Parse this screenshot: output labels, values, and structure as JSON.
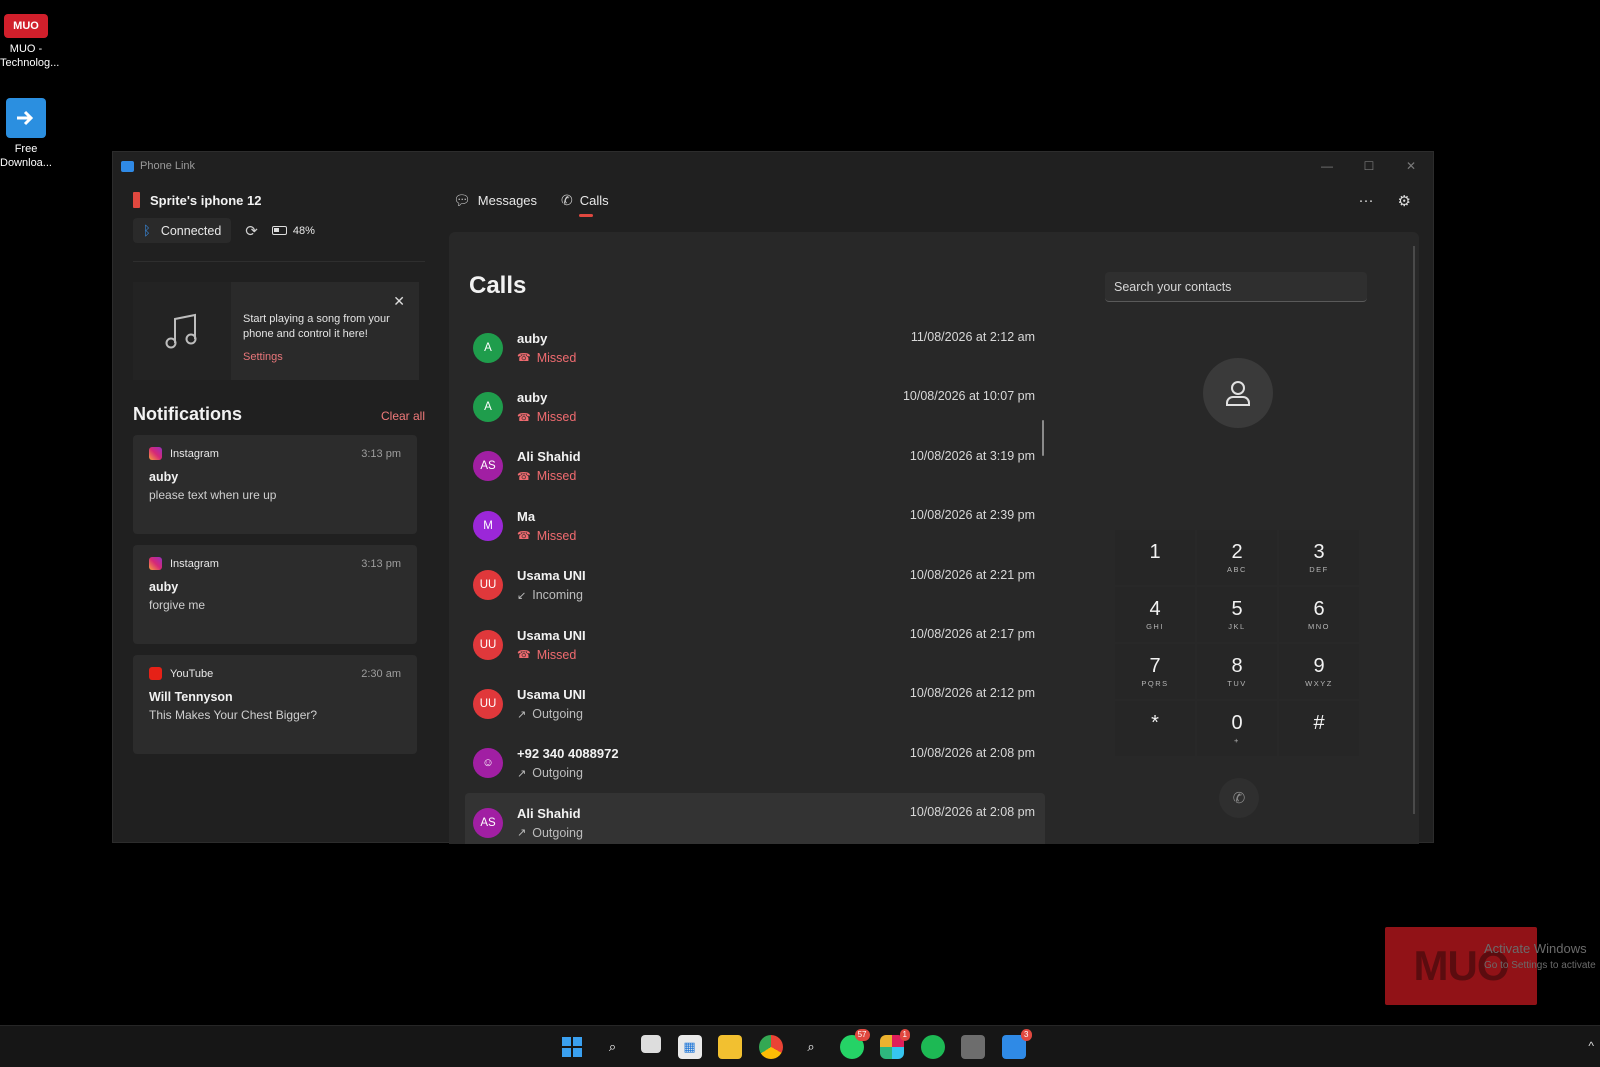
{
  "desktop": {
    "icons": [
      {
        "glyph": "MUO",
        "label": "MUO - Technolog..."
      },
      {
        "glyph": "download-arrow-icon",
        "label": "Free Downloa..."
      }
    ]
  },
  "window": {
    "title": "Phone Link",
    "controls": {
      "minimize": "—",
      "maximize": "☐",
      "close": "✕"
    }
  },
  "device": {
    "name": "Sprite's iphone 12",
    "status": "Connected",
    "battery": "48%"
  },
  "music": {
    "text": "Start playing a song from your phone and control it here!",
    "link": "Settings"
  },
  "notifications": {
    "title": "Notifications",
    "clear_label": "Clear all",
    "items": [
      {
        "app": "Instagram",
        "time": "3:13 pm",
        "who": "auby",
        "body": "please text when ure up"
      },
      {
        "app": "Instagram",
        "time": "3:13 pm",
        "who": "auby",
        "body": "forgive me"
      },
      {
        "app": "YouTube",
        "time": "2:30 am",
        "who": "Will Tennyson",
        "body": "This Makes Your Chest Bigger?"
      }
    ]
  },
  "tabs": {
    "messages": "Messages",
    "calls": "Calls",
    "more": "···"
  },
  "calls": {
    "title": "Calls",
    "items": [
      {
        "initials": "A",
        "name": "auby",
        "status": "Missed",
        "time": "11/08/2026 at 2:12 am"
      },
      {
        "initials": "A",
        "name": "auby",
        "status": "Missed",
        "time": "10/08/2026 at 10:07 pm"
      },
      {
        "initials": "AS",
        "name": "Ali Shahid",
        "status": "Missed",
        "time": "10/08/2026 at 3:19 pm"
      },
      {
        "initials": "M",
        "name": "Ma",
        "status": "Missed",
        "time": "10/08/2026 at 2:39 pm"
      },
      {
        "initials": "UU",
        "name": "Usama UNI",
        "status": "Incoming",
        "time": "10/08/2026 at 2:21 pm"
      },
      {
        "initials": "UU",
        "name": "Usama UNI",
        "status": "Missed",
        "time": "10/08/2026 at 2:17 pm"
      },
      {
        "initials": "UU",
        "name": "Usama UNI",
        "status": "Outgoing",
        "time": "10/08/2026 at 2:12 pm"
      },
      {
        "initials": "",
        "name": "+92 340 4088972",
        "status": "Outgoing",
        "time": "10/08/2026 at 2:08 pm"
      },
      {
        "initials": "AS",
        "name": "Ali Shahid",
        "status": "Outgoing",
        "time": "10/08/2026 at 2:08 pm"
      }
    ]
  },
  "search": {
    "placeholder": "Search your contacts"
  },
  "dialpad": {
    "keys": [
      {
        "digit": "1",
        "letters": ""
      },
      {
        "digit": "2",
        "letters": "ABC"
      },
      {
        "digit": "3",
        "letters": "DEF"
      },
      {
        "digit": "4",
        "letters": "GHI"
      },
      {
        "digit": "5",
        "letters": "JKL"
      },
      {
        "digit": "6",
        "letters": "MNO"
      },
      {
        "digit": "7",
        "letters": "PQRS"
      },
      {
        "digit": "8",
        "letters": "TUV"
      },
      {
        "digit": "9",
        "letters": "WXYZ"
      },
      {
        "digit": "*",
        "letters": ""
      },
      {
        "digit": "0",
        "letters": "+"
      },
      {
        "digit": "#",
        "letters": ""
      }
    ]
  },
  "watermark": {
    "logo": "MUO",
    "activate_title": "Activate Windows",
    "activate_sub": "Go to Settings to activate"
  },
  "taskbar": {
    "badges": {
      "whatsapp": "57",
      "slack": "1",
      "phonelink": "3"
    }
  },
  "colors": {
    "accent": "#e0483f",
    "missed": "#f06b70",
    "avatar_green": "#1f9d4c",
    "avatar_purple": "#a11fa3",
    "avatar_violet": "#9b27d8",
    "avatar_red": "#e0383b"
  }
}
